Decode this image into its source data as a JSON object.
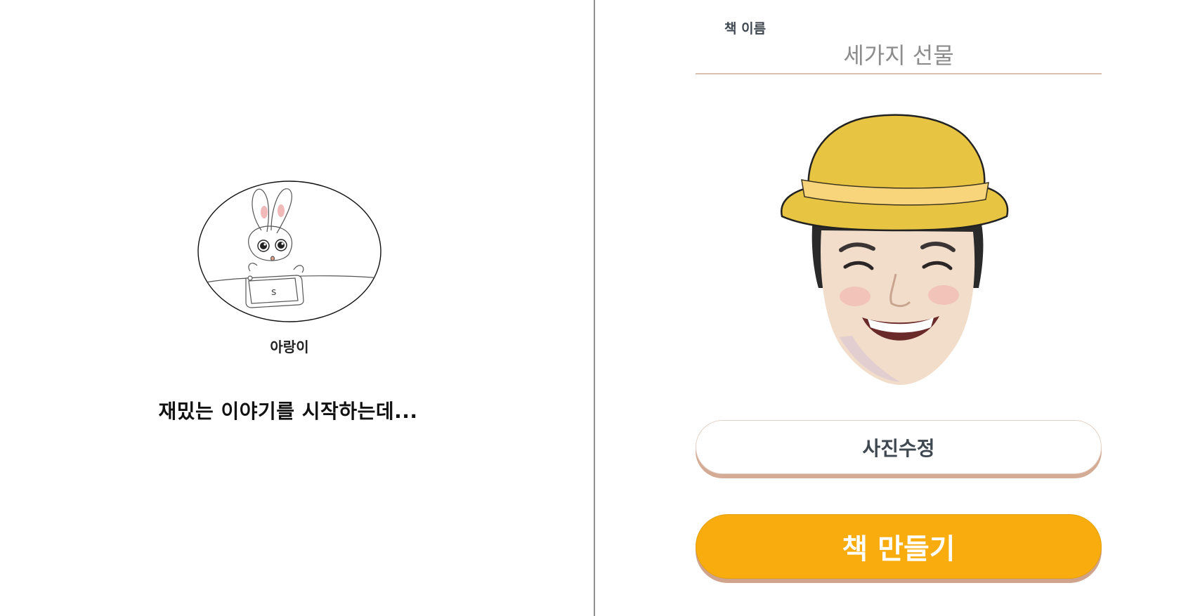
{
  "left_page": {
    "character_name": "아랑이",
    "story_text": "재밌는 이야기를 시작하는데..."
  },
  "right_page": {
    "title_label": "책 이름",
    "title_value": "세가지 선물",
    "edit_photo_label": "사진수정",
    "make_book_label": "책 만들기"
  },
  "colors": {
    "accent": "#f8ac0d",
    "underline": "#dcbfae",
    "button_shadow": "#d4ab94",
    "hat": "#e8c443",
    "hat_band": "#f8d47a"
  }
}
